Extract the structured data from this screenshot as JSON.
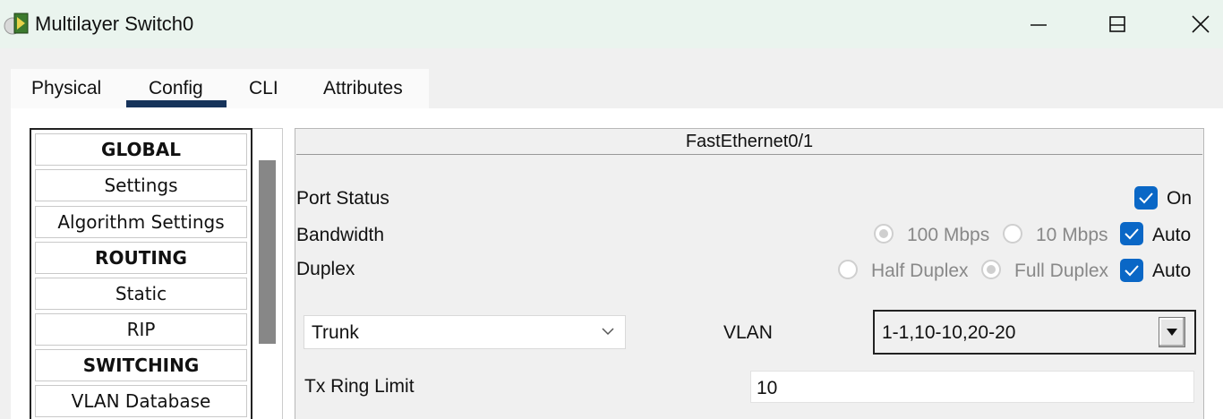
{
  "window": {
    "title": "Multilayer Switch0",
    "icon": "switch-app-icon"
  },
  "window_controls": {
    "minimize": "minimize-icon",
    "maximize": "maximize-icon",
    "close": "close-icon"
  },
  "tabs": [
    {
      "label": "Physical",
      "active": false
    },
    {
      "label": "Config",
      "active": true
    },
    {
      "label": "CLI",
      "active": false
    },
    {
      "label": "Attributes",
      "active": false
    }
  ],
  "sidebar": {
    "items": [
      {
        "label": "GLOBAL",
        "header": true
      },
      {
        "label": "Settings",
        "header": false
      },
      {
        "label": "Algorithm Settings",
        "header": false
      },
      {
        "label": "ROUTING",
        "header": true
      },
      {
        "label": "Static",
        "header": false
      },
      {
        "label": "RIP",
        "header": false
      },
      {
        "label": "SWITCHING",
        "header": true
      },
      {
        "label": "VLAN Database",
        "header": false
      }
    ]
  },
  "interface": {
    "title": "FastEthernet0/1",
    "port_status": {
      "label": "Port Status",
      "on_label": "On",
      "on_checked": true
    },
    "bandwidth": {
      "label": "Bandwidth",
      "opt_100": "100 Mbps",
      "opt_100_selected": true,
      "opt_10": "10 Mbps",
      "opt_10_selected": false,
      "auto_label": "Auto",
      "auto_checked": true
    },
    "duplex": {
      "label": "Duplex",
      "half": "Half Duplex",
      "half_selected": false,
      "full": "Full Duplex",
      "full_selected": true,
      "auto_label": "Auto",
      "auto_checked": true
    },
    "mode": {
      "value": "Trunk"
    },
    "vlan": {
      "label": "VLAN",
      "value": "1-1,10-10,20-20"
    },
    "tx_ring": {
      "label": "Tx Ring Limit",
      "value": "10"
    }
  },
  "colors": {
    "accent": "#0a67c6",
    "tab_underline": "#16335a",
    "titlebar": "#eaf4ee"
  }
}
